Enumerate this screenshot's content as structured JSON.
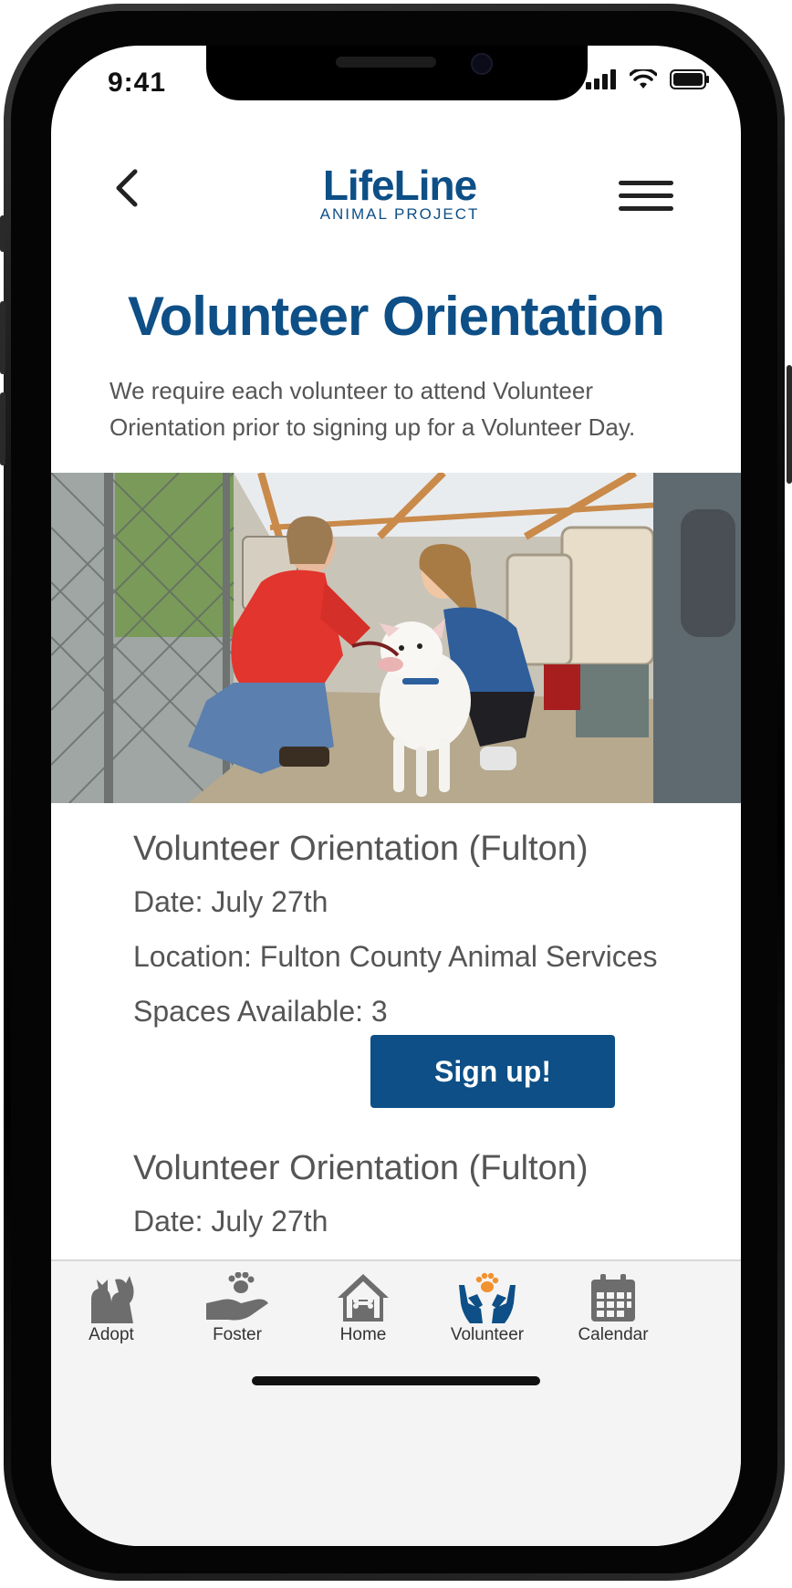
{
  "status_bar": {
    "time": "9:41"
  },
  "header": {
    "logo_main": "LifeLine",
    "logo_sub": "ANIMAL PROJECT"
  },
  "page": {
    "title": "Volunteer Orientation",
    "intro": "We require each volunteer to attend Volunteer Orientation prior to signing up for a Volunteer Day."
  },
  "events": [
    {
      "title": "Volunteer Orientation (Fulton)",
      "date": "Date: July 27th",
      "location": "Location: Fulton County Animal Services",
      "spaces": "Spaces Available: 3",
      "button": "Sign up!"
    },
    {
      "title": "Volunteer Orientation (Fulton)",
      "date": "Date: July 27th"
    }
  ],
  "tabs": [
    {
      "label": "Adopt",
      "icon": "pets-icon"
    },
    {
      "label": "Foster",
      "icon": "hand-paw-icon"
    },
    {
      "label": "Home",
      "icon": "house-bone-icon"
    },
    {
      "label": "Volunteer",
      "icon": "hands-paw-icon",
      "active": true
    },
    {
      "label": "Calendar",
      "icon": "calendar-icon"
    }
  ],
  "colors": {
    "brand_blue": "#0d4f86",
    "accent_orange": "#f2912f",
    "text_gray": "#555555"
  }
}
